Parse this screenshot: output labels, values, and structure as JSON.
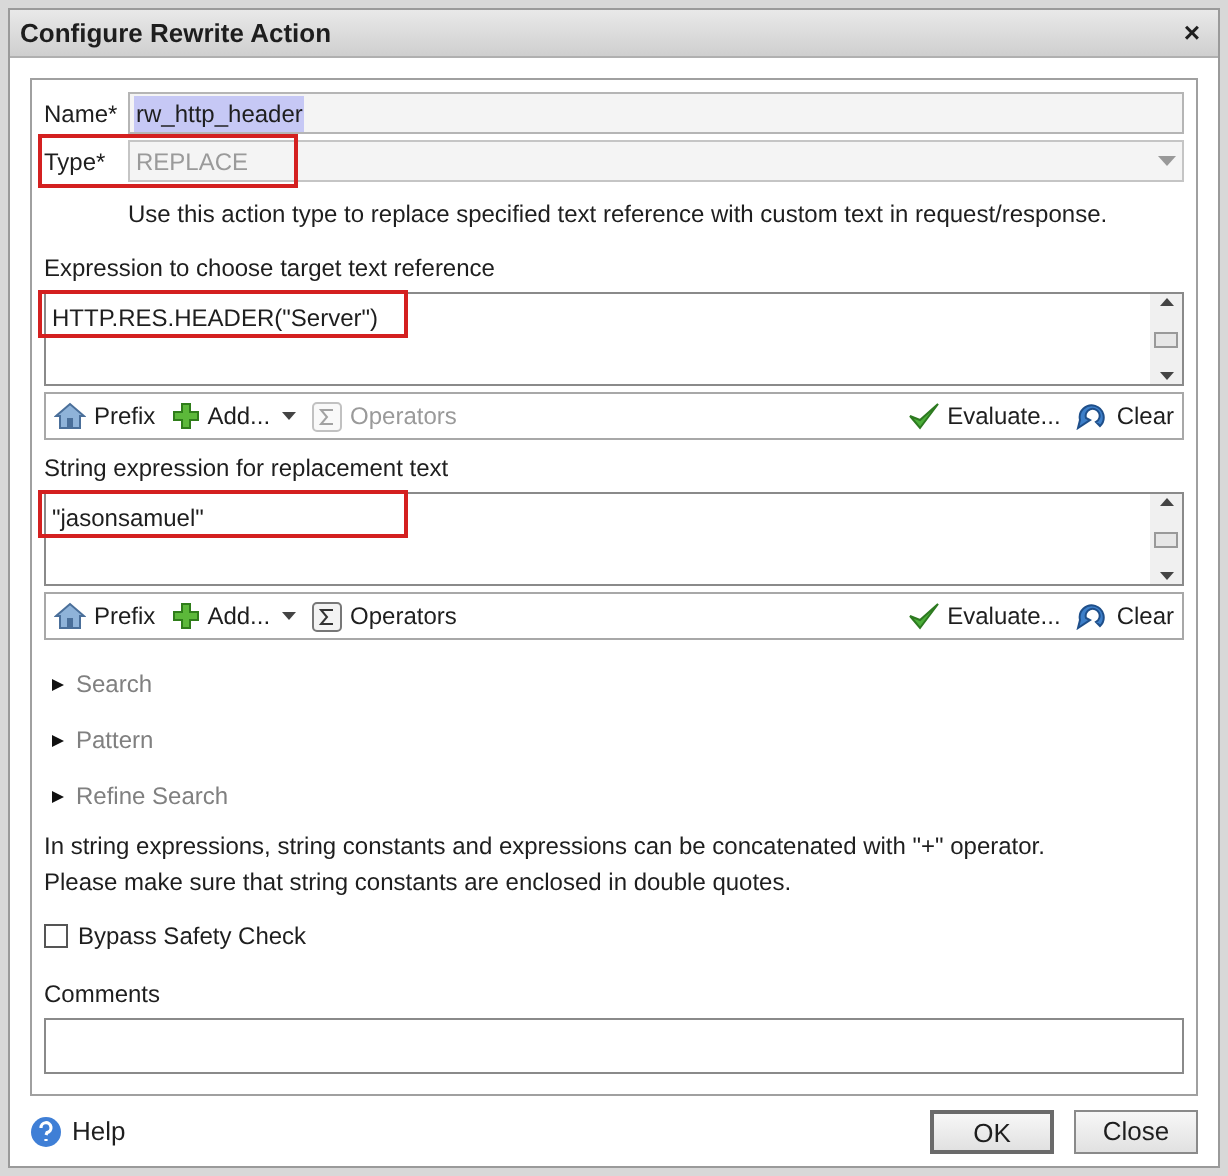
{
  "window": {
    "title": "Configure Rewrite Action",
    "close": "×"
  },
  "name_field": {
    "label": "Name*",
    "value": "rw_http_header",
    "selected": true
  },
  "type_field": {
    "label": "Type*",
    "value": "REPLACE",
    "disabled": true,
    "highlighted": true
  },
  "type_hint": "Use this action type to replace specified text reference with custom text in request/response.",
  "expressions": [
    {
      "label": "Expression to choose target text reference",
      "value": "HTTP.RES.HEADER(\"Server\")",
      "highlighted": true,
      "toolbar": [
        {
          "kind": "prefix",
          "label": "Prefix",
          "disabled": false
        },
        {
          "kind": "add",
          "label": "Add...",
          "disabled": false
        },
        {
          "kind": "operators",
          "label": "Operators",
          "disabled": true
        },
        {
          "kind": "evaluate",
          "label": "Evaluate...",
          "disabled": false
        },
        {
          "kind": "clear",
          "label": "Clear",
          "disabled": false
        }
      ]
    },
    {
      "label": "String expression for replacement text",
      "value": "\"jasonsamuel\"",
      "highlighted": true,
      "toolbar": [
        {
          "kind": "prefix",
          "label": "Prefix",
          "disabled": false
        },
        {
          "kind": "add",
          "label": "Add...",
          "disabled": false
        },
        {
          "kind": "operators",
          "label": "Operators",
          "disabled": false
        },
        {
          "kind": "evaluate",
          "label": "Evaluate...",
          "disabled": false
        },
        {
          "kind": "clear",
          "label": "Clear",
          "disabled": false
        }
      ]
    }
  ],
  "sections": [
    {
      "label": "Search",
      "expanded": false
    },
    {
      "label": "Pattern",
      "expanded": false
    },
    {
      "label": "Refine Search",
      "expanded": false
    }
  ],
  "notes": [
    "In string expressions, string constants and expressions can be concatenated with \"+\" operator.",
    "Please make sure that string constants are enclosed in double quotes."
  ],
  "bypass": {
    "label": "Bypass Safety Check",
    "checked": false
  },
  "comments": {
    "label": "Comments"
  },
  "footer": {
    "help": "Help",
    "buttons": [
      "OK",
      "Close"
    ]
  }
}
